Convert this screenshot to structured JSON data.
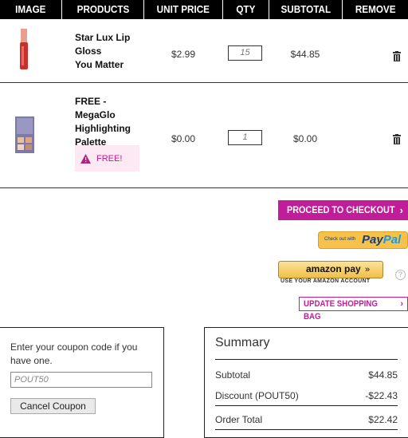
{
  "table_headers": [
    "IMAGE",
    "PRODUCTS",
    "UNIT PRICE",
    "QTY",
    "SUBTOTAL",
    "REMOVE"
  ],
  "items": [
    {
      "name_lines": [
        "Star Lux Lip",
        "Gloss",
        "You Matter"
      ],
      "unit_price": "$2.99",
      "qty": "15",
      "subtotal": "$44.85"
    },
    {
      "name_lines": [
        "FREE - MegaGlo",
        "Highlighting",
        "Palette"
      ],
      "unit_price": "$0.00",
      "qty": "1",
      "subtotal": "$0.00",
      "badge": "FREE!"
    }
  ],
  "actions": {
    "checkout": "PROCEED TO CHECKOUT",
    "paypal_small": "Check out with",
    "paypal_pay": "Pay",
    "paypal_pal": "Pal",
    "amazon_pay": "amazon pay",
    "amazon_sub": "USE YOUR AMAZON ACCOUNT",
    "help": "?",
    "update": "UPDATE SHOPPING BAG"
  },
  "coupon": {
    "prompt": "Enter your coupon code if you have one.",
    "placeholder": "POUT50",
    "cancel": "Cancel Coupon"
  },
  "summary": {
    "title": "Summary",
    "subtotal_label": "Subtotal",
    "subtotal_value": "$44.85",
    "discount_label": "Discount (POUT50)",
    "discount_value": "-$22.43",
    "total_label": "Order Total",
    "total_value": "$22.42"
  },
  "colors": {
    "accent": "#c11d9a",
    "header_bg": "#000000",
    "paypal": "#f7c24c",
    "amazon": "#f1bf47"
  }
}
